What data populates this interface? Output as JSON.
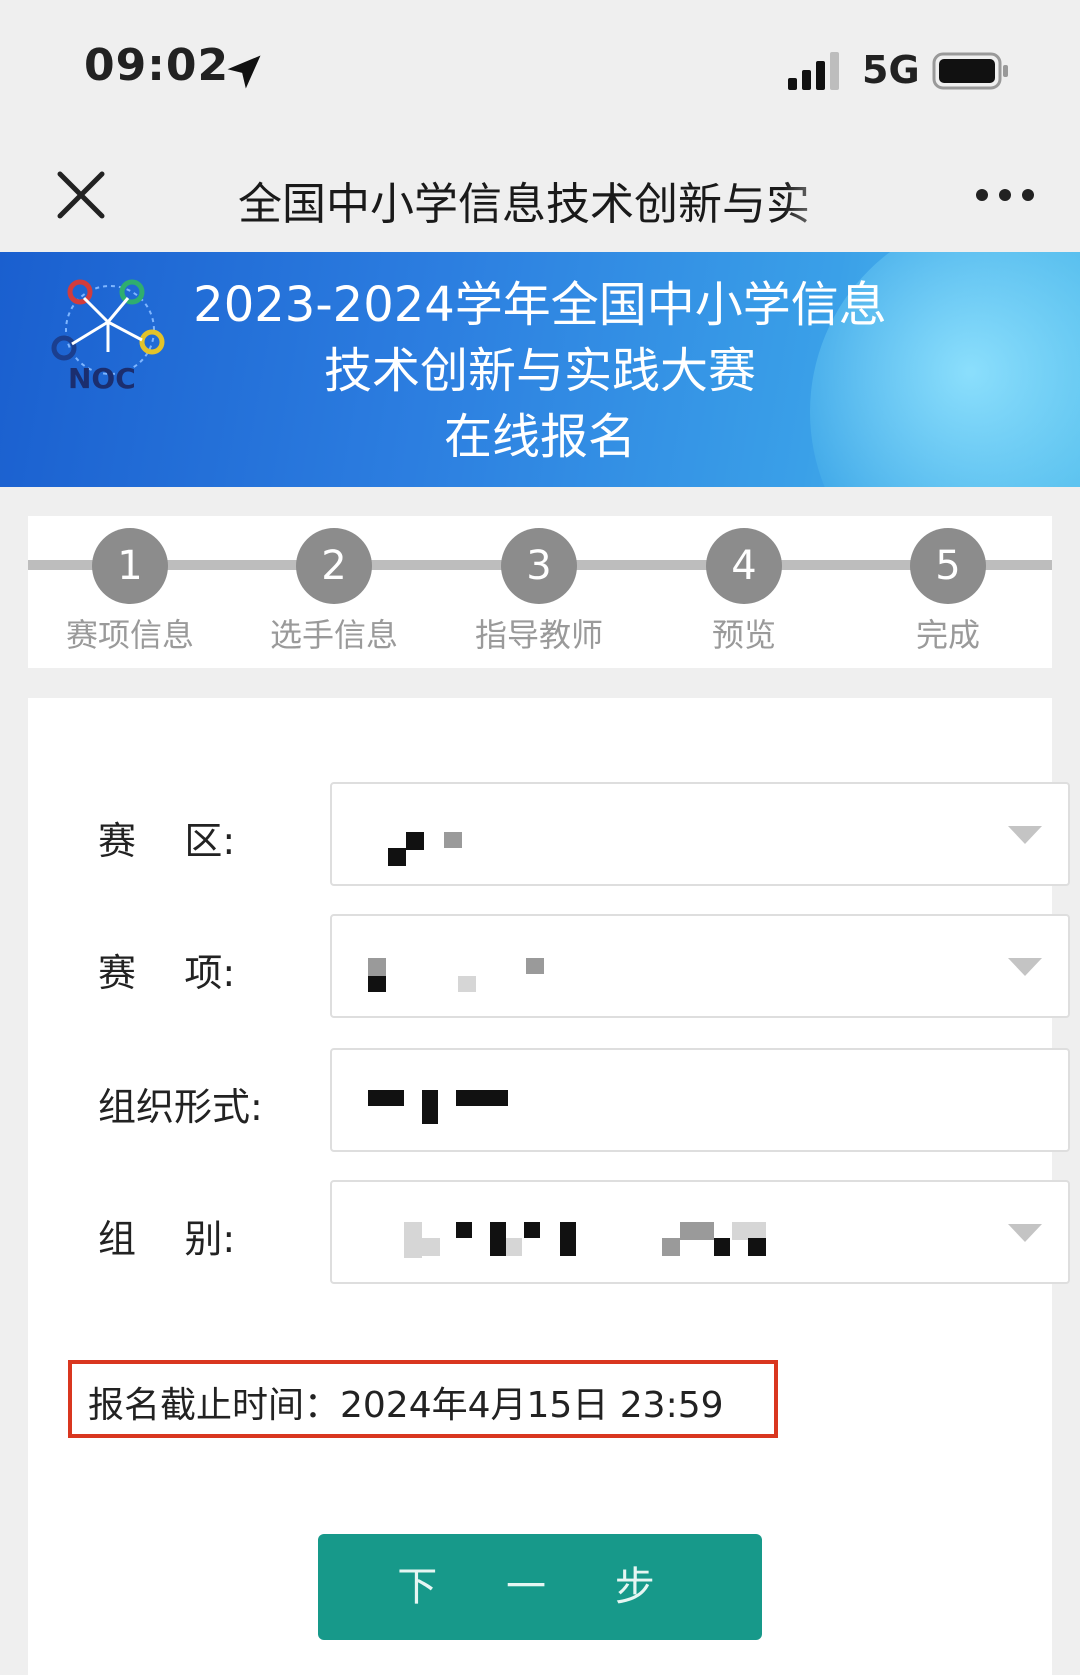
{
  "status_bar": {
    "time": "09:02",
    "network": "5G",
    "icons": [
      "location-arrow-icon",
      "signal-icon",
      "battery-icon"
    ]
  },
  "nav": {
    "title": "全国中小学信息技术创新与实",
    "icons": [
      "close-icon",
      "more-icon"
    ]
  },
  "banner": {
    "logo_text": "NOC",
    "line1": "2023-2024学年全国中小学信息",
    "line2": "技术创新与实践大赛",
    "line3": "在线报名"
  },
  "steps": [
    {
      "num": "1",
      "label": "赛项信息"
    },
    {
      "num": "2",
      "label": "选手信息"
    },
    {
      "num": "3",
      "label": "指导教师"
    },
    {
      "num": "4",
      "label": "预览"
    },
    {
      "num": "5",
      "label": "完成"
    }
  ],
  "form": {
    "region_label": "赛    区:",
    "event_label": "赛    项:",
    "org_form_label": "组织形式:",
    "group_label": "组    别:"
  },
  "deadline": "报名截止时间：2024年4月15日 23:59",
  "next_button": "下 一 步",
  "colors": {
    "accent": "#17998a",
    "highlight_border": "#d9361f",
    "banner_blue": "#2c7ee0",
    "step_grey": "#8c8c8c"
  }
}
